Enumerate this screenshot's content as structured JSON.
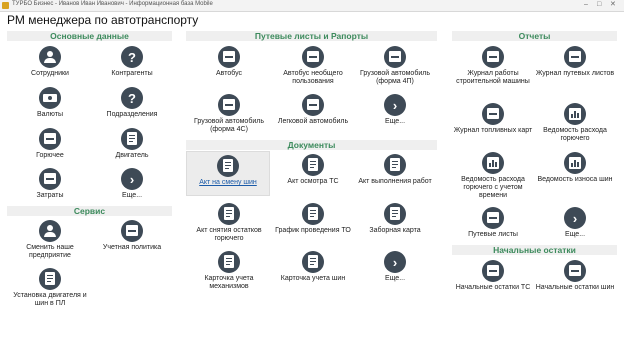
{
  "window": {
    "title": "ТУРБО Бизнес - Иванов Иван Иванович - Информационная база Mobile",
    "minimize": "–",
    "maximize": "□",
    "close": "✕"
  },
  "page": {
    "title": "РМ менеджера по автотранспорту"
  },
  "sections": {
    "main_data": "Основные данные",
    "service": "Сервис",
    "waybills": "Путевые листы и Рапорты",
    "documents": "Документы",
    "reports": "Отчеты",
    "initial": "Начальные остатки"
  },
  "tiles": {
    "employees": "Сотрудники",
    "counterparties": "Контрагенты",
    "currencies": "Валюты",
    "departments": "Подразделения",
    "fuel": "Горючее",
    "engine": "Двигатель",
    "costs": "Затраты",
    "main_more": "Еще...",
    "change_enterprise": "Сменить наше предприятие",
    "accounting_policy": "Учетная политика",
    "engine_tires_install": "Установка двигателя и шин в ПЛ",
    "bus": "Автобус",
    "bus_non_public": "Автобус необщего пользования",
    "truck_4p": "Грузовой автомобиль (форма 4П)",
    "truck_4c": "Грузовой автомобиль (форма 4С)",
    "car": "Легковой автомобиль",
    "waybills_more": "Еще...",
    "tire_change_act": "Акт на смену шин",
    "vehicle_inspection_act": "Акт осмотра ТС",
    "work_completion_act": "Акт выполнения работ",
    "fuel_writeoff_act": "Акт снятия остатков горючего",
    "maintenance_schedule": "График проведения ТО",
    "fuel_card": "Заборная карта",
    "mechanism_card": "Карточка учета механизмов",
    "tire_card": "Карточка учета шин",
    "docs_more": "Еще...",
    "construction_journal": "Журнал работы строительной машины",
    "waybill_journal": "Журнал путевых листов",
    "fuel_card_journal": "Журнал топливных карт",
    "fuel_consumption": "Ведомость расхода горючего",
    "fuel_consumption_time": "Ведомость расхода горючего с учетом времени",
    "tire_wear": "Ведомость износа шин",
    "waybill_list": "Путевые листы",
    "reports_more": "Еще...",
    "initial_vehicles": "Начальные остатки ТС",
    "initial_tires": "Начальные остатки шин"
  }
}
